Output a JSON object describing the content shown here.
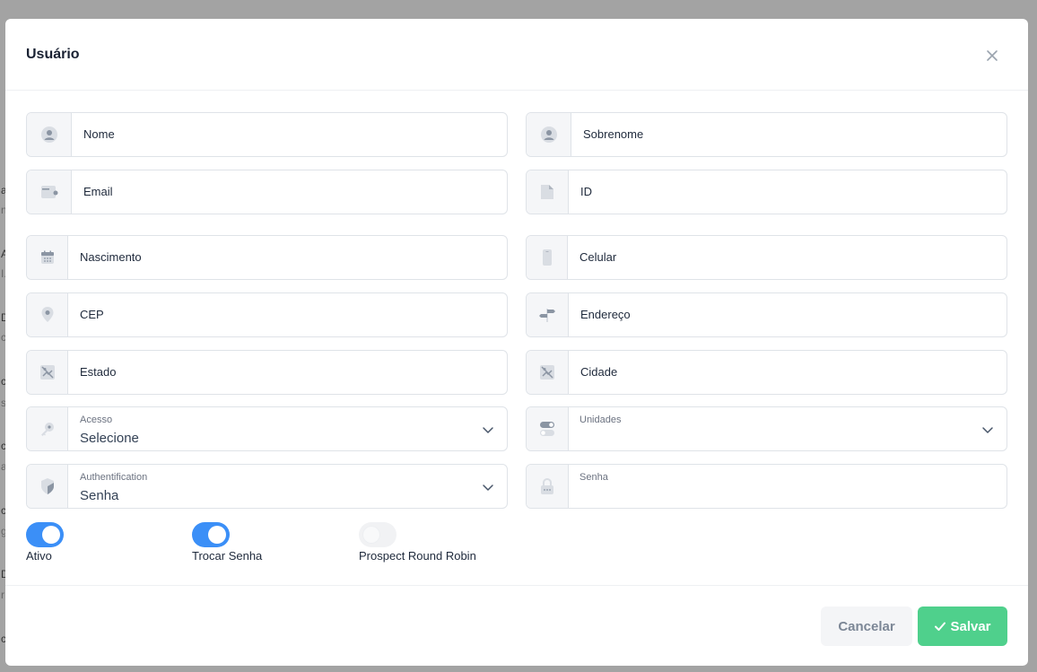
{
  "modal": {
    "title": "Usuário",
    "close_icon": "close-icon"
  },
  "fields": {
    "nome": {
      "placeholder": "Nome",
      "icon": "user-icon"
    },
    "sobrenome": {
      "placeholder": "Sobrenome",
      "icon": "user-icon"
    },
    "email": {
      "placeholder": "Email",
      "icon": "wallet-icon"
    },
    "id": {
      "placeholder": "ID",
      "icon": "document-icon"
    },
    "nascimento": {
      "placeholder": "Nascimento",
      "icon": "calendar-icon"
    },
    "celular": {
      "placeholder": "Celular",
      "icon": "phone-icon"
    },
    "cep": {
      "placeholder": "CEP",
      "icon": "location-pin-icon"
    },
    "endereco": {
      "placeholder": "Endereço",
      "icon": "signpost-icon"
    },
    "estado": {
      "placeholder": "Estado",
      "icon": "map-icon"
    },
    "cidade": {
      "placeholder": "Cidade",
      "icon": "map-icon"
    },
    "acesso": {
      "label": "Acesso",
      "value": "Selecione",
      "icon": "key-icon"
    },
    "unidades": {
      "label": "Unidades",
      "value": "",
      "icon": "toggle-icon"
    },
    "authentification": {
      "label": "Authentification",
      "value": "Senha",
      "icon": "shield-icon"
    },
    "senha": {
      "label": "Senha",
      "value": "",
      "icon": "lock-icon"
    }
  },
  "toggles": {
    "ativo": {
      "label": "Ativo",
      "on": true
    },
    "trocar_senha": {
      "label": "Trocar Senha",
      "on": true
    },
    "prospect_round_robin": {
      "label": "Prospect Round Robin",
      "on": false
    }
  },
  "footer": {
    "cancel_label": "Cancelar",
    "save_label": "Salvar"
  },
  "colors": {
    "primary": "#3b8ff7",
    "success": "#4fd08c",
    "border": "#dfe3e8",
    "addon_bg": "#f5f6f8",
    "backdrop": "#9a9a9a"
  }
}
